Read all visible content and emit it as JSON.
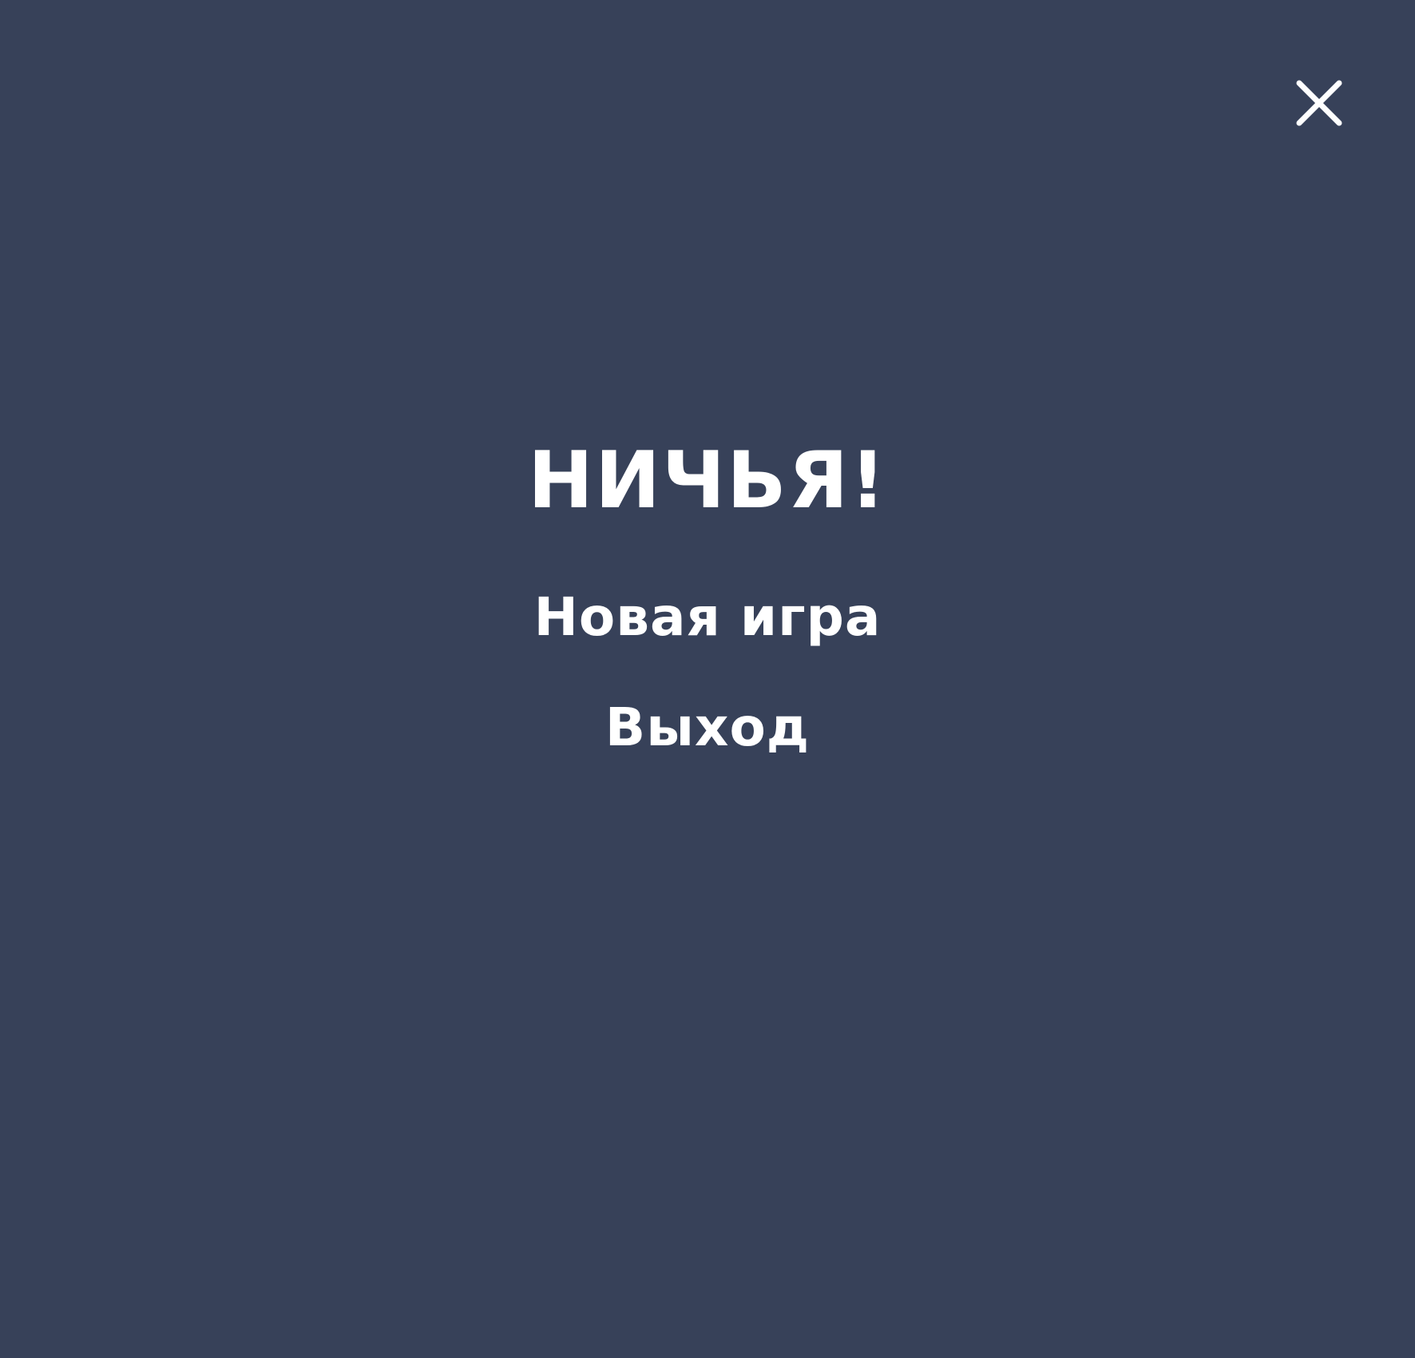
{
  "screen": {
    "background_color": "#374159",
    "text_color": "#ffffff"
  },
  "close": {
    "icon": "close-icon"
  },
  "result": {
    "title": "НИЧЬЯ!"
  },
  "menu": {
    "new_game_label": "Новая игра",
    "exit_label": "Выход"
  }
}
